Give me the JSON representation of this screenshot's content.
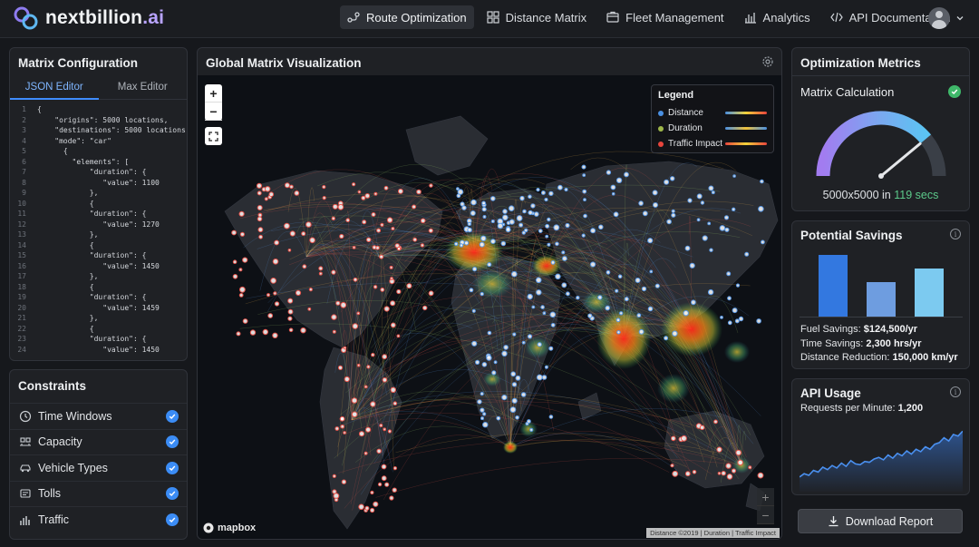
{
  "brand": {
    "name": "nextbillion",
    "suffix": ".ai"
  },
  "nav": {
    "items": [
      {
        "label": "Route Optimization",
        "icon": "route-icon"
      },
      {
        "label": "Distance Matrix",
        "icon": "grid-icon"
      },
      {
        "label": "Fleet Management",
        "icon": "truck-icon"
      },
      {
        "label": "Analytics",
        "icon": "bar-chart-icon"
      },
      {
        "label": "API Documentation",
        "icon": "code-icon"
      }
    ],
    "active": "Route Optimization"
  },
  "matrix_config": {
    "title": "Matrix Configuration",
    "tabs": [
      "JSON Editor",
      "Max Editor"
    ],
    "active_tab": "JSON Editor",
    "code_lines": [
      "{",
      "    \"origins\": 5000 locations,",
      "    \"destinations\": 5000 locations,",
      "    \"mode\": \"car\"",
      "      {",
      "        \"elements\": [",
      "            \"duration\": {",
      "               \"value\": 1100",
      "            },",
      "            {",
      "            \"duration\": {",
      "               \"value\": 1270",
      "            },",
      "            {",
      "            \"duration\": {",
      "               \"value\": 1450",
      "            },",
      "            {",
      "            \"duration\": {",
      "               \"value\": 1459",
      "            },",
      "            {",
      "            \"duration\": {",
      "               \"value\": 1450"
    ]
  },
  "constraints": {
    "title": "Constraints",
    "items": [
      {
        "label": "Time Windows",
        "icon": "clock-icon",
        "checked": true
      },
      {
        "label": "Capacity",
        "icon": "capacity-icon",
        "checked": true
      },
      {
        "label": "Vehicle Types",
        "icon": "car-icon",
        "checked": true
      },
      {
        "label": "Tolls",
        "icon": "toll-icon",
        "checked": true
      },
      {
        "label": "Traffic",
        "icon": "traffic-icon",
        "checked": true
      }
    ]
  },
  "map": {
    "title": "Global Matrix Visualization",
    "legend": {
      "title": "Legend",
      "items": [
        {
          "label": "Distance",
          "color": "#4a90e2"
        },
        {
          "label": "Duration",
          "color": "#9fb84a"
        },
        {
          "label": "Traffic Impact",
          "color": "#e8453c"
        }
      ]
    },
    "zoom_in": "+",
    "zoom_out": "−",
    "provider": "mapbox",
    "attribution": "Distance ©2019 | Duration | Traffic Impact"
  },
  "metrics": {
    "title": "Optimization Metrics",
    "calc_label": "Matrix Calculation",
    "status": "ok",
    "gauge_fraction": 0.78,
    "caption_prefix": "5000x5000 in",
    "caption_value": "119 secs"
  },
  "savings": {
    "title": "Potential Savings",
    "bars": [
      {
        "value": 0.92,
        "color": "#3378e0"
      },
      {
        "value": 0.52,
        "color": "#6e9de0"
      },
      {
        "value": 0.72,
        "color": "#7ccaf0"
      }
    ],
    "fuel_label": "Fuel Savings:",
    "fuel_value": "$124,500/yr",
    "time_label": "Time Savings:",
    "time_value": "2,300 hrs/yr",
    "distance_label": "Distance Reduction:",
    "distance_value": "150,000 km/yr"
  },
  "api": {
    "title": "API Usage",
    "rpm_label": "Requests per Minute:",
    "rpm_value": "1,200",
    "series": [
      18,
      22,
      20,
      26,
      24,
      30,
      27,
      32,
      29,
      35,
      31,
      38,
      34,
      33,
      37,
      36,
      40,
      42,
      39,
      45,
      41,
      47,
      44,
      50,
      46,
      52,
      49,
      55,
      52,
      58,
      60,
      66,
      62,
      70,
      68,
      74
    ]
  },
  "download_label": "Download Report"
}
